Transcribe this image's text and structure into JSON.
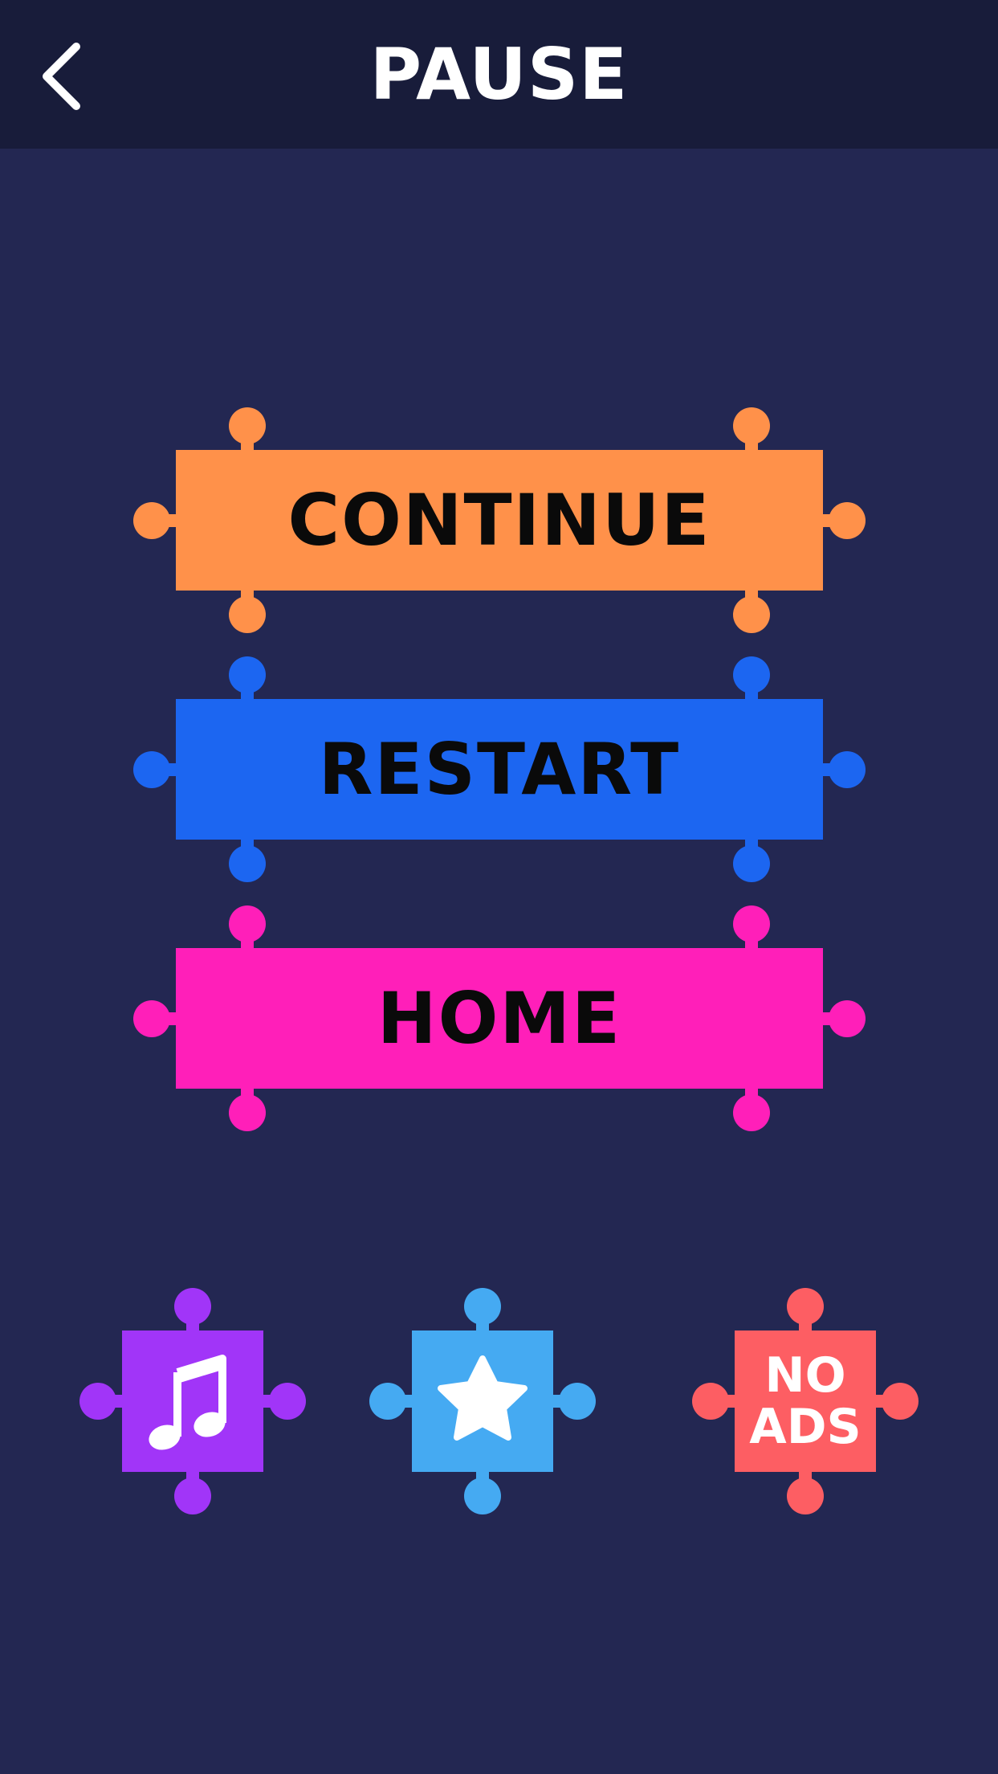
{
  "header": {
    "title": "PAUSE",
    "back_icon": "chevron-left-icon"
  },
  "menu": {
    "continue_label": "CONTINUE",
    "restart_label": "RESTART",
    "home_label": "HOME"
  },
  "actions": {
    "music_icon": "music-note-icon",
    "rate_icon": "star-icon",
    "noads_line1": "NO",
    "noads_line2": "ADS"
  },
  "colors": {
    "background": "#232752",
    "header": "#181c3a",
    "continue": "#ff914a",
    "restart": "#1c66f1",
    "home": "#ff1fb9",
    "music": "#a135f8",
    "rate": "#45aaf2",
    "noads": "#fd5e63"
  }
}
